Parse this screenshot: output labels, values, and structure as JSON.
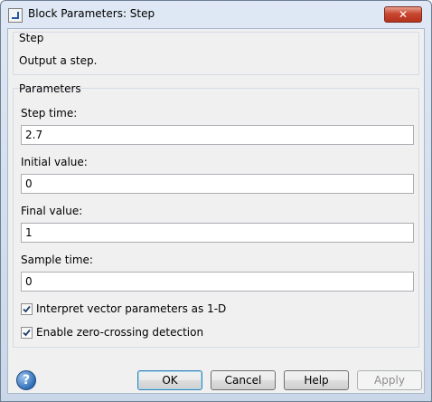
{
  "window": {
    "title": "Block Parameters: Step",
    "close_glyph": "✕"
  },
  "block_group": {
    "title": "Step",
    "description": "Output a step."
  },
  "params_group": {
    "title": "Parameters",
    "fields": [
      {
        "label": "Step time:",
        "value": "2.7"
      },
      {
        "label": "Initial value:",
        "value": "0"
      },
      {
        "label": "Final value:",
        "value": "1"
      },
      {
        "label": "Sample time:",
        "value": "0"
      }
    ],
    "checkboxes": [
      {
        "label": "Interpret vector parameters as 1-D",
        "checked": true
      },
      {
        "label": "Enable zero-crossing detection",
        "checked": true
      }
    ]
  },
  "buttons": {
    "help_glyph": "?",
    "ok": "OK",
    "cancel": "Cancel",
    "help": "Help",
    "apply": "Apply"
  },
  "icons": {
    "app": "block-step-icon",
    "help": "help-icon",
    "close": "close-icon"
  }
}
